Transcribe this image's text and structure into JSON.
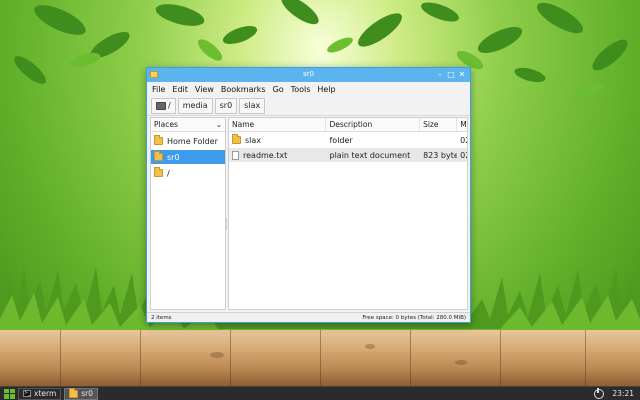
{
  "window": {
    "title": "sr0",
    "minimize_icon": "minimize-icon",
    "maximize_icon": "maximize-icon",
    "close_icon": "close-icon"
  },
  "menubar": {
    "items": [
      {
        "label": "File"
      },
      {
        "label": "Edit"
      },
      {
        "label": "View"
      },
      {
        "label": "Bookmarks"
      },
      {
        "label": "Go"
      },
      {
        "label": "Tools"
      },
      {
        "label": "Help"
      }
    ]
  },
  "pathbar": {
    "root_label": "/",
    "segments": [
      "media",
      "sr0",
      "slax"
    ]
  },
  "places": {
    "header": "Places",
    "items": [
      {
        "label": "Home Folder"
      },
      {
        "label": "sr0"
      },
      {
        "label": "/"
      }
    ]
  },
  "filelist": {
    "columns": [
      "Name",
      "Description",
      "Size",
      "M"
    ],
    "rows": [
      {
        "name": "slax",
        "description": "folder",
        "size": "",
        "modified": "02"
      },
      {
        "name": "readme.txt",
        "description": "plain text document",
        "size": "823 bytes",
        "modified": "02"
      }
    ]
  },
  "status": {
    "items": "2 items",
    "free_space": "Free space: 0 bytes (Total: 280.0 MiB)"
  },
  "taskbar": {
    "tasks": [
      {
        "label": "xterm"
      },
      {
        "label": "sr0"
      }
    ],
    "clock": "23:21"
  },
  "colors": {
    "accent": "#3d9be9",
    "titlebar": "#5cb4ee",
    "taskbar": "#2b2b2b"
  }
}
